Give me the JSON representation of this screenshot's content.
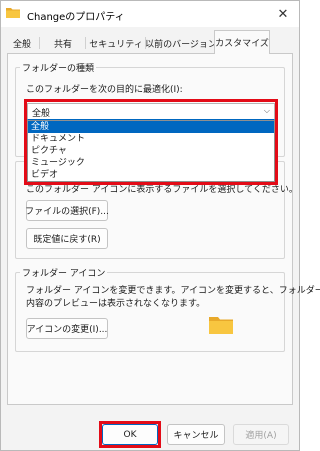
{
  "window": {
    "title": "Changeのプロパティ",
    "close_glyph": "✕",
    "icon": "folder-icon"
  },
  "tabs": [
    {
      "label": "全般"
    },
    {
      "label": "共有"
    },
    {
      "label": "セキュリティ"
    },
    {
      "label": "以前のバージョン"
    },
    {
      "label": "カスタマイズ",
      "active": true
    }
  ],
  "folder_type": {
    "group_title": "フォルダーの種類",
    "optimize_label": "このフォルダーを次の目的に最適化(I):",
    "selected_value": "全般",
    "dropdown_arrow": "⌵",
    "options": [
      "全般",
      "ドキュメント",
      "ピクチャ",
      "ミュージック",
      "ビデオ"
    ]
  },
  "folder_picture": {
    "description": "このフォルダー アイコンに表示するファイルを選択してください。",
    "choose_file_button": "ファイルの選択(F)...",
    "restore_default_button": "既定値に戻す(R)"
  },
  "folder_icon": {
    "group_title": "フォルダー アイコン",
    "description_line1": "フォルダー アイコンを変更できます。アイコンを変更すると、フォルダーの",
    "description_line2": "内容のプレビューは表示されなくなります。",
    "change_icon_button": "アイコンの変更(I)...",
    "preview_icon": "folder-icon"
  },
  "footer": {
    "ok_button": "OK",
    "cancel_button": "キャンセル",
    "apply_button": "適用(A)"
  },
  "colors": {
    "highlight_red": "#e30b17",
    "selection_blue": "#0067c0",
    "folder_yellow": "#f8c640"
  }
}
